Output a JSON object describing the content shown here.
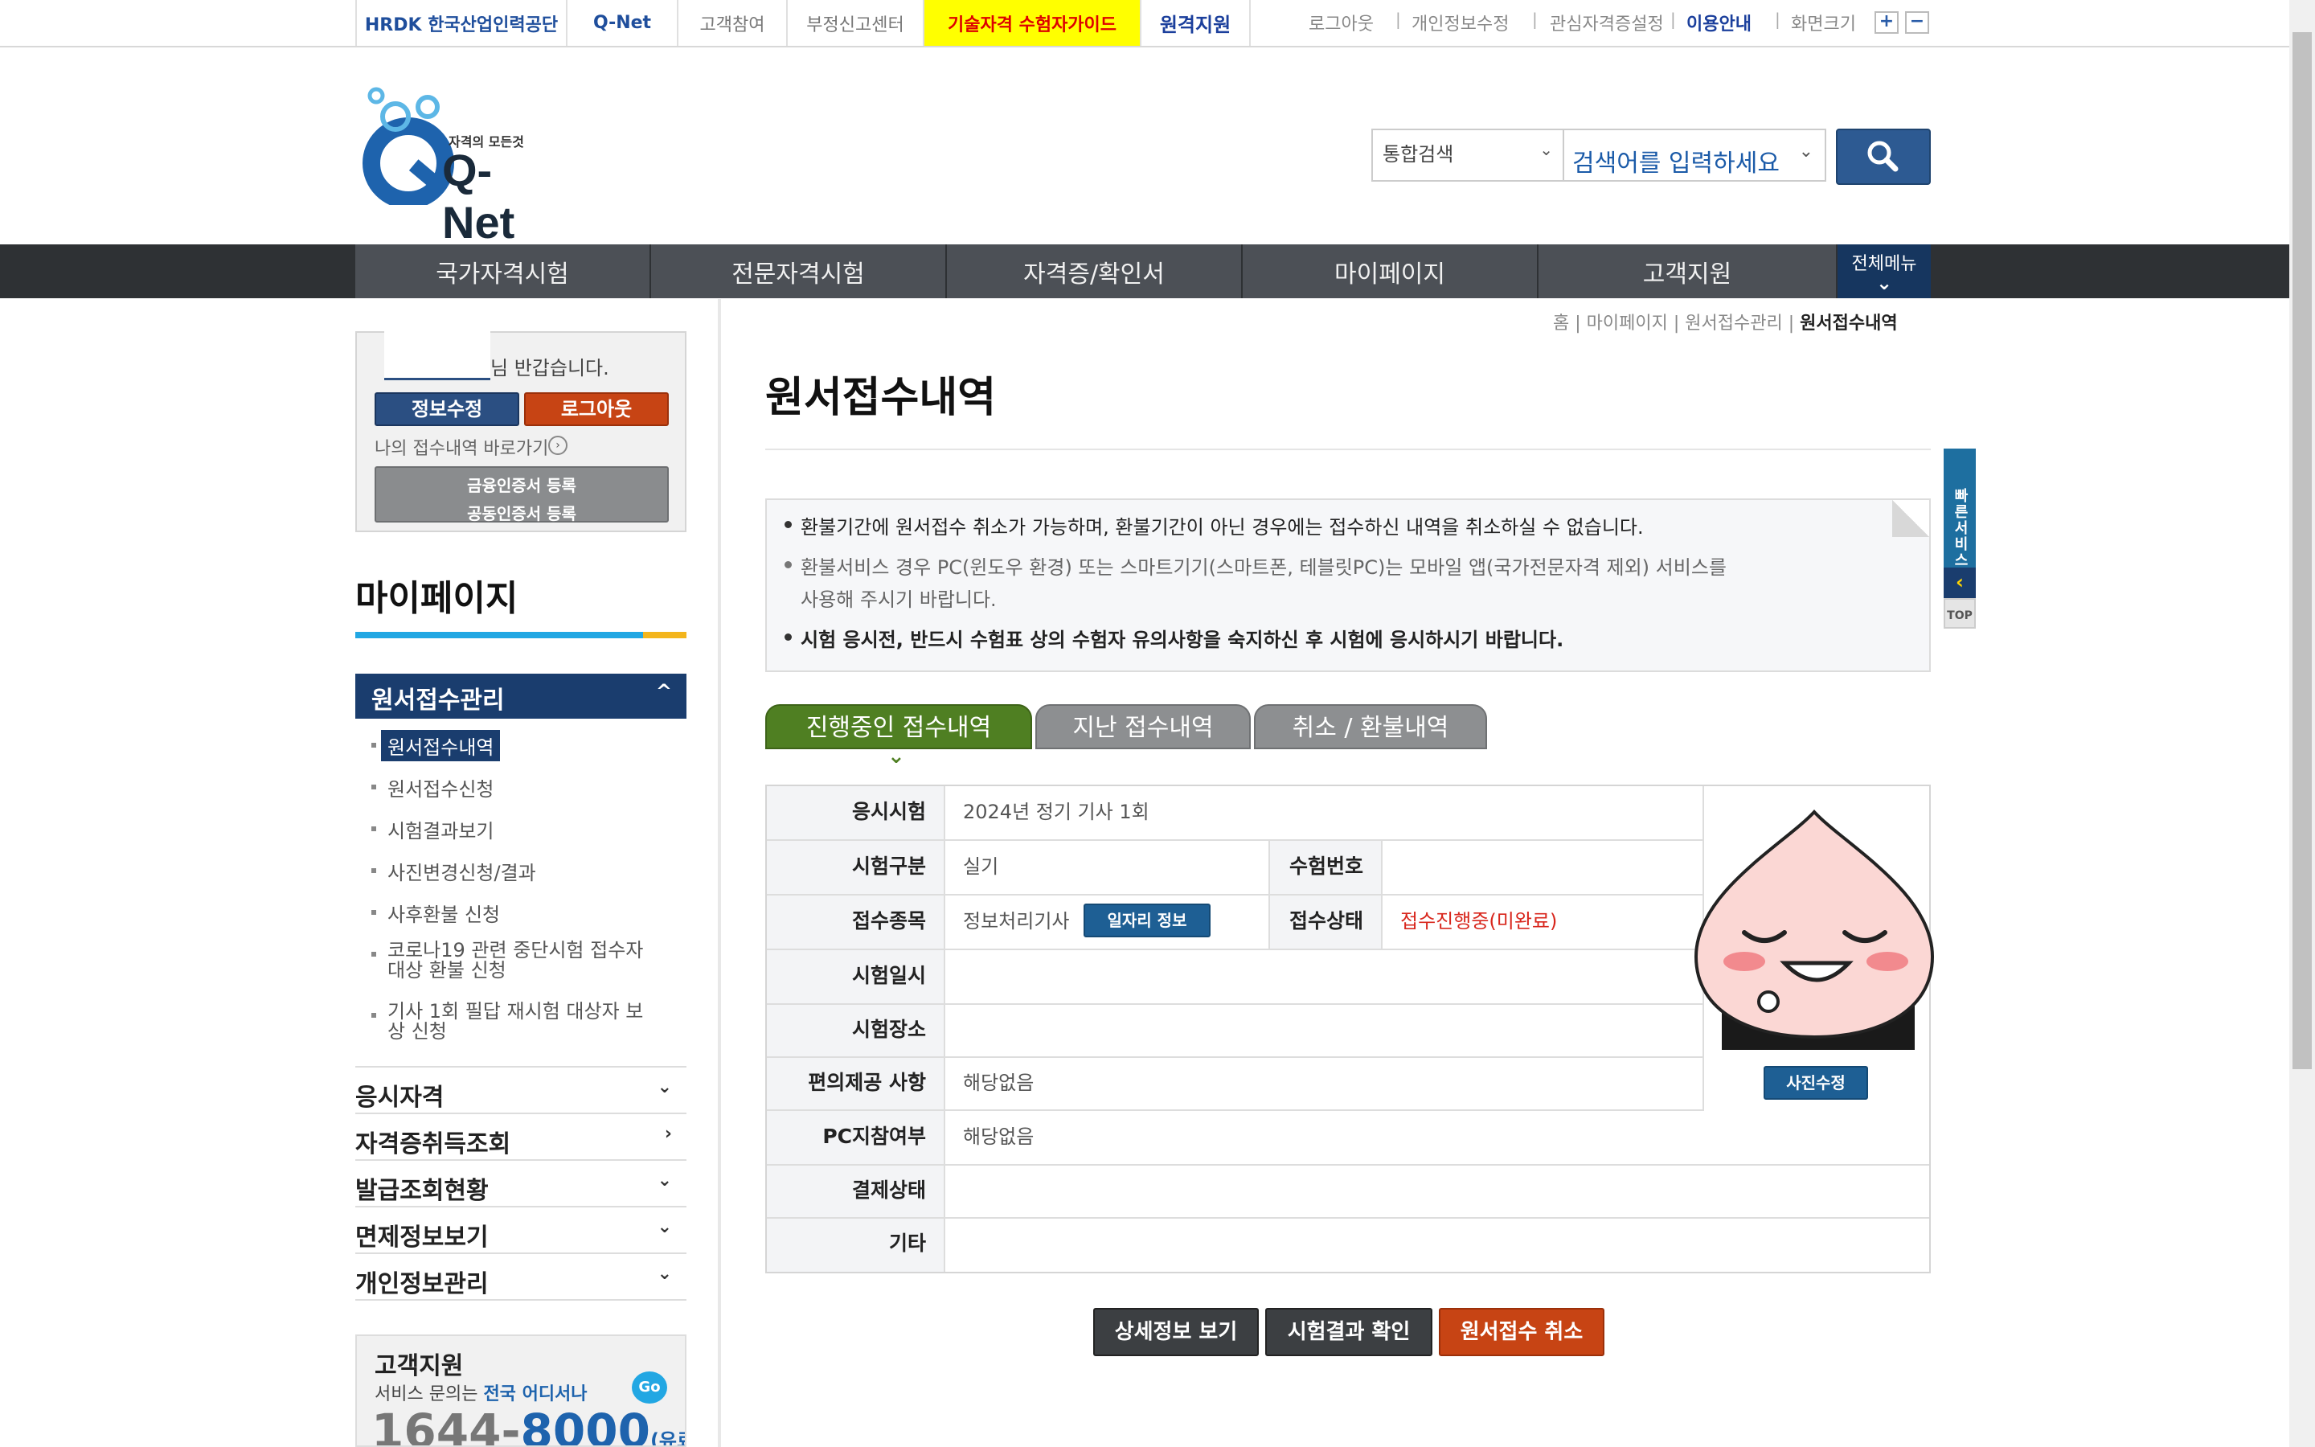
{
  "topbar": {
    "hrdk_logo_text": "HRDK 한국산업인력공단",
    "qnet_small_logo_text": "Q-Net",
    "links": [
      "고객참여",
      "부정신고센터"
    ],
    "guide_label": "기술자격 수험자가이드",
    "remote_label": "원격지원",
    "util": [
      "로그아웃",
      "개인정보수정",
      "관심자격증설정",
      "이용안내",
      "화면크기"
    ],
    "zoom_in": "+",
    "zoom_out": "−"
  },
  "header": {
    "logo_tagline": "자격의 모든것",
    "logo_text": "Q-Net",
    "search_select": "통합검색",
    "search_placeholder": "검색어를 입력하세요"
  },
  "gnb": {
    "items": [
      "국가자격시험",
      "전문자격시험",
      "자격증/확인서",
      "마이페이지",
      "고객지원"
    ],
    "all_menu": "전체메뉴"
  },
  "breadcrumb": [
    "홈",
    "마이페이지",
    "원서접수관리",
    "원서접수내역"
  ],
  "login": {
    "greeting": "님 반갑습니다.",
    "edit_btn": "정보수정",
    "logout_btn": "로그아웃",
    "my_link": "나의 접수내역 바로가기",
    "cert_line1": "금융인증서 등록",
    "cert_line2": "공동인증서 등록"
  },
  "lnb": {
    "title": "마이페이지",
    "active_group": "원서접수관리",
    "sub_items": [
      "원서접수내역",
      "원서접수신청",
      "시험결과보기",
      "사진변경신청/결과",
      "사후환불 신청",
      "코로나19 관련 중단시험 접수자",
      "대상 환불 신청",
      "기사 1회 필답 재시험 대상자 보",
      "상 신청"
    ],
    "groups": [
      "응시자격",
      "자격증취득조회",
      "발급조회현황",
      "면제정보보기",
      "개인정보관리"
    ],
    "support_title": "고객지원",
    "support_desc_prefix": "서비스 문의는",
    "support_desc_emph": "전국 어디서나",
    "go": "Go",
    "phone_a": "1644",
    "phone_dash": "-",
    "phone_b": "8000",
    "phone_suffix": "(유료)"
  },
  "main": {
    "page_title": "원서접수내역",
    "notices": [
      "환불기간에 원서접수 취소가 가능하며, 환불기간이 아닌 경우에는 접수하신 내역을 취소하실 수 없습니다.",
      "환불서비스 경우 PC(윈도우 환경) 또는 스마트기기(스마트폰, 테블릿PC)는 모바일 앱(국가전문자격 제외) 서비스를",
      "사용해 주시기 바랍니다.",
      "시험 응시전, 반드시 수험표 상의 수험자 유의사항을 숙지하신 후 시험에 응시하시기 바랍니다."
    ],
    "tabs": [
      "진행중인 접수내역",
      "지난 접수내역",
      "취소 / 환불내역"
    ],
    "table": {
      "exam_label": "응시시험",
      "exam_value": "2024년 정기 기사 1회",
      "type_label": "시험구분",
      "type_value": "실기",
      "examno_label": "수험번호",
      "examno_value": "",
      "item_label": "접수종목",
      "item_value": "정보처리기사",
      "job_btn": "일자리 정보",
      "status_label": "접수상태",
      "status_value": "접수진행중(미완료)",
      "date_label": "시험일시",
      "date_value": "",
      "place_label": "시험장소",
      "place_value": "",
      "conv_label": "편의제공 사항",
      "conv_value": "해당없음",
      "pc_label": "PC지참여부",
      "pc_value": "해당없음",
      "pay_label": "결제상태",
      "pay_value": "",
      "etc_label": "기타",
      "etc_value": "",
      "photo_btn": "사진수정"
    },
    "actions": [
      "상세정보 보기",
      "시험결과 확인",
      "원서접수 취소"
    ]
  },
  "quick": {
    "label": "빠른서비스",
    "top": "TOP"
  },
  "colors": {
    "active_tab": "#4f7f22",
    "status_red": "#d8261c",
    "lnb_active": "#1a3d6e",
    "guide_yellow": "#ffff00"
  }
}
